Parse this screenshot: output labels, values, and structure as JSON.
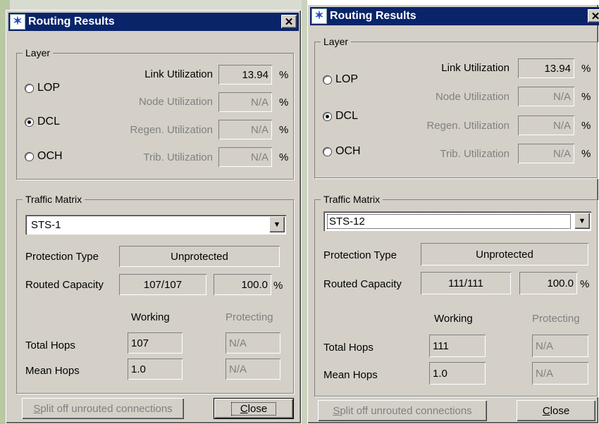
{
  "dialogs": [
    {
      "title": "Routing Results",
      "close_glyph": "✕",
      "layer_group": "Layer",
      "layers": [
        {
          "label": "LOP",
          "selected": false
        },
        {
          "label": "DCL",
          "selected": true
        },
        {
          "label": "OCH",
          "selected": false
        }
      ],
      "utilizations": [
        {
          "label": "Link Utilization",
          "value": "13.94",
          "unit": "%"
        },
        {
          "label": "Node Utilization",
          "value": "N/A",
          "unit": "%"
        },
        {
          "label": "Regen. Utilization",
          "value": "N/A",
          "unit": "%"
        },
        {
          "label": "Trib. Utilization",
          "value": "N/A",
          "unit": "%"
        }
      ],
      "traffic_group": "Traffic Matrix",
      "traffic_selected": "STS-1",
      "protection_label": "Protection Type",
      "protection_value": "Unprotected",
      "capacity_label": "Routed Capacity",
      "capacity_value": "107/107",
      "capacity_pct": "100.0",
      "capacity_unit": "%",
      "working_header": "Working",
      "protecting_header": "Protecting",
      "total_hops_label": "Total Hops",
      "total_hops_working": "107",
      "total_hops_protecting": "N/A",
      "mean_hops_label": "Mean Hops",
      "mean_hops_working": "1.0",
      "mean_hops_protecting": "N/A",
      "split_button_first": "S",
      "split_button_rest": "plit off unrouted connections",
      "close_button_first": "C",
      "close_button_rest": "lose"
    },
    {
      "title": "Routing Results",
      "close_glyph": "✕",
      "layer_group": "Layer",
      "layers": [
        {
          "label": "LOP",
          "selected": false
        },
        {
          "label": "DCL",
          "selected": true
        },
        {
          "label": "OCH",
          "selected": false
        }
      ],
      "utilizations": [
        {
          "label": "Link Utilization",
          "value": "13.94",
          "unit": "%"
        },
        {
          "label": "Node Utilization",
          "value": "N/A",
          "unit": "%"
        },
        {
          "label": "Regen. Utilization",
          "value": "N/A",
          "unit": "%"
        },
        {
          "label": "Trib. Utilization",
          "value": "N/A",
          "unit": "%"
        }
      ],
      "traffic_group": "Traffic Matrix",
      "traffic_selected": "STS-12",
      "protection_label": "Protection Type",
      "protection_value": "Unprotected",
      "capacity_label": "Routed Capacity",
      "capacity_value": "111/111",
      "capacity_pct": "100.0",
      "capacity_unit": "%",
      "working_header": "Working",
      "protecting_header": "Protecting",
      "total_hops_label": "Total Hops",
      "total_hops_working": "111",
      "total_hops_protecting": "N/A",
      "mean_hops_label": "Mean Hops",
      "mean_hops_working": "1.0",
      "mean_hops_protecting": "N/A",
      "split_button_first": "S",
      "split_button_rest": "plit off unrouted connections",
      "close_button_first": "C",
      "close_button_rest": "lose"
    }
  ]
}
